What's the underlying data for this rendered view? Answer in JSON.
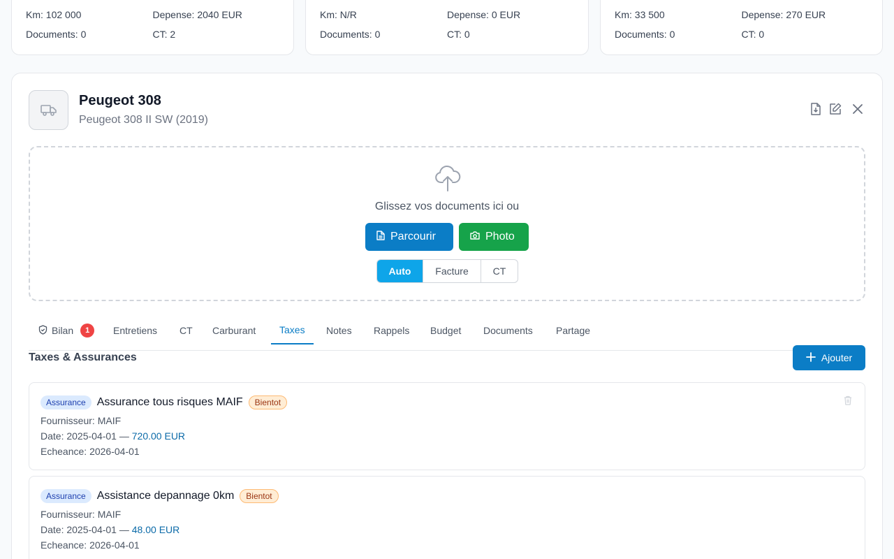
{
  "summary_cards": [
    {
      "km": "Km: 102 000",
      "depense": "Depense: 2040 EUR",
      "documents": "Documents: 0",
      "ct": "CT: 2"
    },
    {
      "km": "Km: N/R",
      "depense": "Depense: 0 EUR",
      "documents": "Documents: 0",
      "ct": "CT: 0"
    },
    {
      "km": "Km: 33 500",
      "depense": "Depense: 270 EUR",
      "documents": "Documents: 0",
      "ct": "CT: 0"
    }
  ],
  "vehicle": {
    "title": "Peugeot 308",
    "subtitle": "Peugeot 308 II SW (2019)",
    "icon": "truck-icon"
  },
  "header_actions": [
    "download-icon",
    "edit-icon",
    "close-icon"
  ],
  "upload": {
    "prompt": "Glissez vos documents ici ou",
    "browse_label": "Parcourir",
    "photo_label": "Photo",
    "types": [
      "Auto",
      "Facture",
      "CT"
    ],
    "selected_type": "Auto"
  },
  "tabs": [
    {
      "label": "Bilan",
      "badge": "1"
    },
    {
      "label": "Entretiens"
    },
    {
      "label": "CT"
    },
    {
      "label": "Carburant"
    },
    {
      "label": "Taxes"
    },
    {
      "label": "Notes"
    },
    {
      "label": "Rappels"
    },
    {
      "label": "Budget"
    },
    {
      "label": "Documents"
    },
    {
      "label": "Partage"
    }
  ],
  "active_tab": "Taxes",
  "section": {
    "title": "Taxes & Assurances",
    "add_label": "Ajouter"
  },
  "entries": [
    {
      "tag": "Assurance",
      "name": "Assurance tous risques MAIF",
      "status": "Bientot",
      "supplier_label": "Fournisseur:",
      "supplier": "MAIF",
      "date_label": "Date:",
      "date": "2025-04-01",
      "sep": "—",
      "amount": "720.00 EUR",
      "due_label": "Echeance:",
      "due": "2026-04-01"
    },
    {
      "tag": "Assurance",
      "name": "Assistance depannage 0km",
      "status": "Bientot",
      "supplier_label": "Fournisseur:",
      "supplier": "MAIF",
      "date_label": "Date:",
      "date": "2025-04-01",
      "sep": "—",
      "amount": "48.00 EUR",
      "due_label": "Echeance:",
      "due": "2026-04-01"
    }
  ],
  "colors": {
    "primary": "#0b7dc6",
    "success": "#16a34a",
    "segment_active": "#0ea5e9",
    "badge": "#ef4444"
  }
}
